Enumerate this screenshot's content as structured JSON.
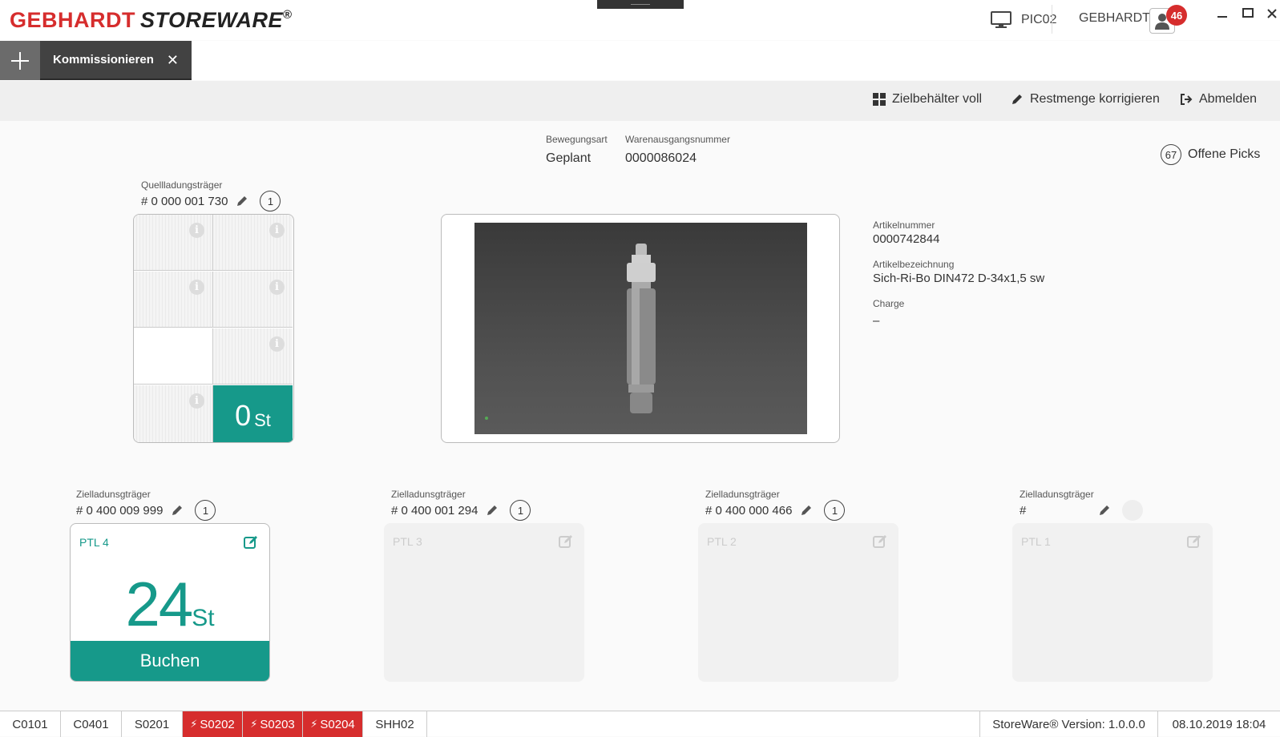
{
  "app": {
    "logo_part1": "GEBHARDT",
    "logo_part2": "STOREWARE",
    "logo_reg": "®",
    "station": "PIC02",
    "user": "GEBHARDT",
    "notification_count": "46"
  },
  "tabs": [
    {
      "label": "Kommissionieren"
    }
  ],
  "toolbar": {
    "zielbehaelter": "Zielbehälter voll",
    "restmenge": "Restmenge korrigieren",
    "abmelden": "Abmelden"
  },
  "header": {
    "bewegungsart_label": "Bewegungsart",
    "bewegungsart_value": "Geplant",
    "warenausgang_label": "Warenausgangsnummer",
    "warenausgang_value": "0000086024",
    "offene_picks_count": "67",
    "offene_picks_label": "Offene Picks"
  },
  "quelle": {
    "label": "Quellladungsträger",
    "number": "# 0 000 001 730",
    "count": "1",
    "active_qty": "0",
    "active_unit": "St"
  },
  "artikel": {
    "nummer_label": "Artikelnummer",
    "nummer_value": "0000742844",
    "bez_label": "Artikelbezeichnung",
    "bez_value": "Sich-Ri-Bo DIN472 D-34x1,5 sw",
    "charge_label": "Charge",
    "charge_value": "–"
  },
  "ziel": [
    {
      "label": "Zielladunsgträger",
      "number": "# 0 400 009 999",
      "count": "1",
      "ptl": "PTL 4",
      "qty": "24",
      "unit": "St",
      "button": "Buchen"
    },
    {
      "label": "Zielladunsgträger",
      "number": "# 0 400 001 294",
      "count": "1",
      "ptl": "PTL 3"
    },
    {
      "label": "Zielladunsgträger",
      "number": "# 0 400 000 466",
      "count": "1",
      "ptl": "PTL 2"
    },
    {
      "label": "Zielladunsgträger",
      "number": "#",
      "count": "",
      "ptl": "PTL 1"
    }
  ],
  "statusbar": {
    "items": [
      "C0101",
      "C0401",
      "S0201",
      "S0202",
      "S0203",
      "S0204",
      "SHH02"
    ],
    "version": "StoreWare® Version: 1.0.0.0",
    "datetime": "08.10.2019 18:04"
  },
  "colors": {
    "accent": "#16998a",
    "brand_red": "#d62d2d"
  }
}
